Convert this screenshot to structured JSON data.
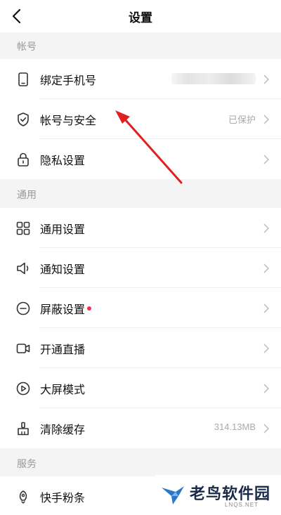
{
  "header": {
    "title": "设置",
    "back_icon": "chevron-left-icon"
  },
  "sections": [
    {
      "title": "帐号"
    },
    {
      "title": "通用"
    },
    {
      "title": "服务"
    }
  ],
  "account_items": [
    {
      "label": "绑定手机号",
      "icon": "phone-icon",
      "value": ""
    },
    {
      "label": "帐号与安全",
      "icon": "shield-check-icon",
      "value": "已保护"
    },
    {
      "label": "隐私设置",
      "icon": "lock-icon",
      "value": ""
    }
  ],
  "general_items": [
    {
      "label": "通用设置",
      "icon": "grid-icon",
      "value": ""
    },
    {
      "label": "通知设置",
      "icon": "speaker-icon",
      "value": ""
    },
    {
      "label": "屏蔽设置",
      "icon": "minus-circle-icon",
      "value": "",
      "badge": true
    },
    {
      "label": "开通直播",
      "icon": "video-camera-icon",
      "value": ""
    },
    {
      "label": "大屏模式",
      "icon": "play-screen-icon",
      "value": ""
    },
    {
      "label": "清除缓存",
      "icon": "broom-icon",
      "value": "314.13MB"
    }
  ],
  "service_items": [
    {
      "label": "快手粉条",
      "icon": "rocket-icon",
      "value": ""
    }
  ],
  "watermark": {
    "brand": "老鸟软件园",
    "domain": "LNQS.NET"
  },
  "colors": {
    "badge": "#fe2c55",
    "arrow": "#e02020",
    "section_bg": "#f4f4f4"
  }
}
